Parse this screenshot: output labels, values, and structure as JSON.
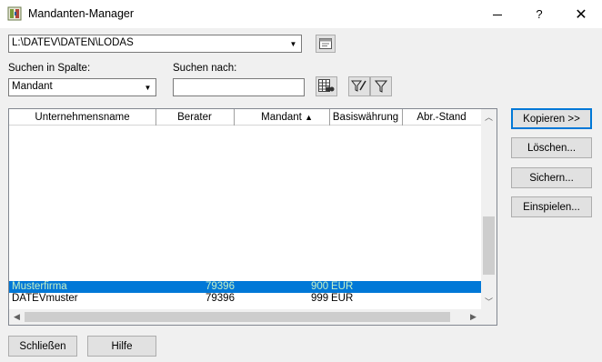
{
  "window": {
    "title": "Mandanten-Manager",
    "help_label": "?",
    "close_label": "✕"
  },
  "path_combo": {
    "value": "L:\\DATEV\\DATEN\\LODAS"
  },
  "search": {
    "column_label": "Suchen in Spalte:",
    "column_value": "Mandant",
    "query_label": "Suchen nach:",
    "query_value": ""
  },
  "table": {
    "columns": [
      "Unternehmensname",
      "Berater",
      "Mandant",
      "Basiswährung",
      "Abr.-Stand"
    ],
    "sort_indicator": "▲",
    "rows": [
      {
        "name": "Musterfirma",
        "berater": "79396",
        "mandant": "900",
        "waehrung": "EUR",
        "stand": ""
      },
      {
        "name": "DATEVmuster",
        "berater": "79396",
        "mandant": "999",
        "waehrung": "EUR",
        "stand": ""
      }
    ],
    "selected_row": 0
  },
  "actions": {
    "kopieren": "Kopieren >>",
    "loeschen": "Löschen...",
    "sichern": "Sichern...",
    "einspielen": "Einspielen..."
  },
  "footer": {
    "schliessen": "Schließen",
    "hilfe": "Hilfe"
  },
  "colors": {
    "selection": "#0078d7",
    "selection_text": "#c5f0c5",
    "default_button_border": "#0078d7"
  }
}
